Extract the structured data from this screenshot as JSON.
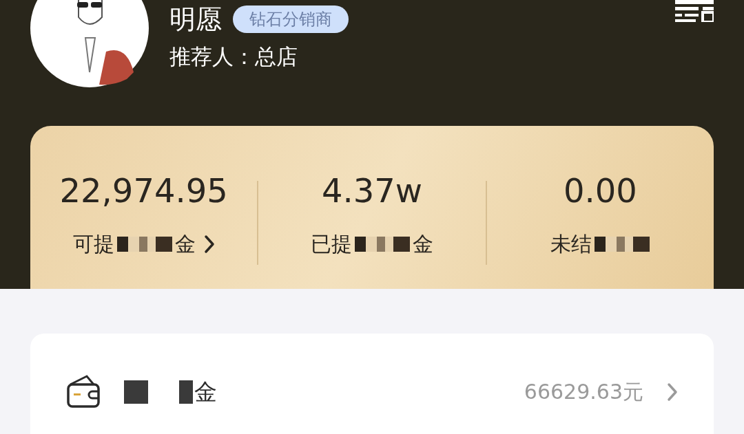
{
  "profile": {
    "name": "明愿",
    "badge": "钻石分销商",
    "referrer": "推荐人：总店"
  },
  "stats": [
    {
      "value": "22,974.95",
      "label_start": "可提",
      "label_end": "金",
      "link": true
    },
    {
      "value": "4.37w",
      "label_start": "已提",
      "label_end": "金",
      "link": false
    },
    {
      "value": "0.00",
      "label_start": "未结",
      "link": false
    }
  ],
  "rows": [
    {
      "label_end": "金",
      "value": "66629.63元",
      "link": true
    }
  ]
}
